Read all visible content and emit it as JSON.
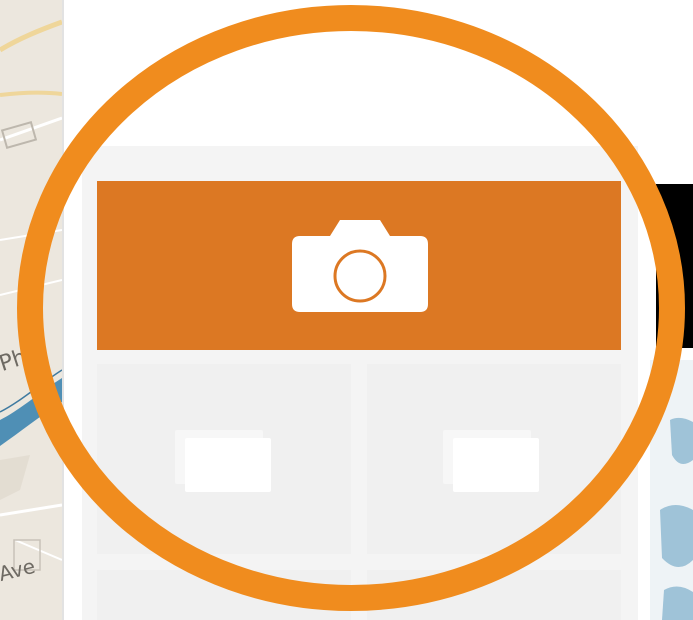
{
  "map": {
    "labels": {
      "partial_label_1": "Ph",
      "partial_label_2": "Ave"
    },
    "water_color": "#4f8fb5",
    "land_color": "#ece7de",
    "road_color": "#ffffff",
    "highway_color": "#efd69a"
  },
  "gallery": {
    "camera_button": {
      "icon": "camera-icon",
      "color": "#dc7823"
    },
    "thumbnails": [
      {
        "icon": "photo-stack-icon"
      },
      {
        "icon": "photo-stack-icon"
      },
      {
        "icon": "photo-stack-icon"
      },
      {
        "icon": "photo-stack-icon"
      }
    ]
  },
  "highlight": {
    "shape": "circle",
    "color": "#f08c1e"
  }
}
